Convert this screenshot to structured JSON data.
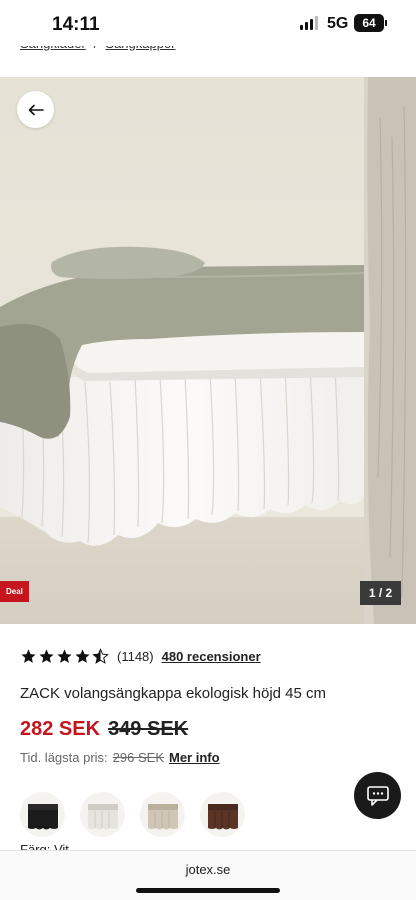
{
  "status_bar": {
    "time": "14:11",
    "network": "5G",
    "battery": "64"
  },
  "breadcrumb": {
    "items": [
      "Sängkläder",
      "Sängkappor"
    ],
    "separator": "/"
  },
  "gallery": {
    "counter": "1 / 2",
    "deal_label": "Deal"
  },
  "product": {
    "rating": 4.5,
    "review_count": "(1148)",
    "reviews_link": "480 recensioner",
    "title": "ZACK volangsängkappa ekologisk höjd 45 cm",
    "price_now": "282 SEK",
    "price_old": "349 SEK",
    "lowest_label": "Tid. lägsta pris:",
    "lowest_price": "296 SEK",
    "more_info": "Mer info",
    "color_label": "Färg: Vit",
    "swatches": [
      {
        "name": "black",
        "color": "#1b1b1b"
      },
      {
        "name": "white",
        "color": "#e6e4df"
      },
      {
        "name": "beige",
        "color": "#cfc6b6"
      },
      {
        "name": "brown",
        "color": "#5a3426"
      }
    ]
  },
  "browser": {
    "url": "jotex.se"
  },
  "colors": {
    "accent_red": "#c4161c",
    "dark": "#1a1a1a"
  }
}
